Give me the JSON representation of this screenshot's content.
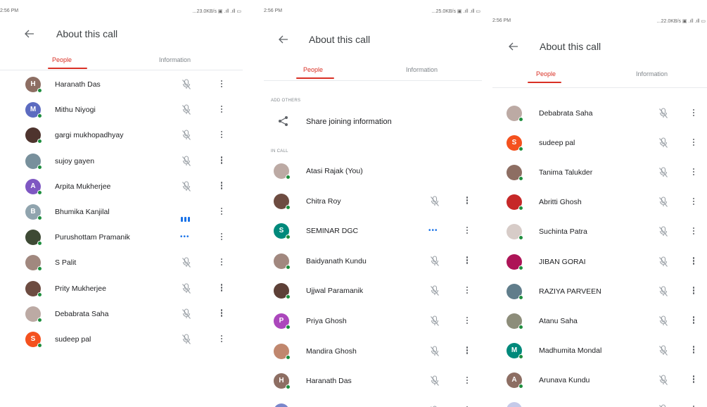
{
  "screens": [
    {
      "status": {
        "time": "2:56 PM",
        "sys": "...23.0KB/s ▣ .ıll .ıll ▭"
      },
      "title": "About this call",
      "tabs": {
        "people": "People",
        "information": "Information"
      },
      "rows": [
        {
          "name": "Haranath Das",
          "initial": "H",
          "color": "#8d6e63",
          "state": "muted"
        },
        {
          "name": "Mithu Niyogi",
          "initial": "M",
          "color": "#5c6bc0",
          "state": "muted"
        },
        {
          "name": "gargi mukhopadhyay",
          "initial": "",
          "color": "#4e342e",
          "state": "muted"
        },
        {
          "name": "sujoy gayen",
          "initial": "",
          "color": "#78909c",
          "state": "muted"
        },
        {
          "name": "Arpita Mukherjee",
          "initial": "A",
          "color": "#7e57c2",
          "state": "muted"
        },
        {
          "name": "Bhumika Kanjilal",
          "initial": "B",
          "color": "#90a4ae",
          "state": "speaking"
        },
        {
          "name": "Purushottam Pramanik",
          "initial": "",
          "color": "#3e4a35",
          "state": "dots"
        },
        {
          "name": "S Palit",
          "initial": "",
          "color": "#a1887f",
          "state": "muted"
        },
        {
          "name": "Prity Mukherjee",
          "initial": "",
          "color": "#6d4c41",
          "state": "muted"
        },
        {
          "name": "Debabrata Saha",
          "initial": "",
          "color": "#bcaaa4",
          "state": "muted"
        },
        {
          "name": "sudeep pal",
          "initial": "S",
          "color": "#f4511e",
          "state": "muted"
        }
      ]
    },
    {
      "status": {
        "time": "2:56 PM",
        "sys": "...25.0KB/s ▣ .ıll .ıll ▭"
      },
      "title": "About this call",
      "tabs": {
        "people": "People",
        "information": "Information"
      },
      "add_others_label": "ADD OTHERS",
      "share_label": "Share joining information",
      "in_call_label": "IN CALL",
      "rows": [
        {
          "name": "Atasi Rajak (You)",
          "initial": "",
          "color": "#bcaaa4",
          "state": "none"
        },
        {
          "name": "Chitra Roy",
          "initial": "",
          "color": "#6d4c41",
          "state": "muted"
        },
        {
          "name": "SEMINAR DGC",
          "initial": "S",
          "color": "#00897b",
          "state": "dots"
        },
        {
          "name": "Baidyanath Kundu",
          "initial": "",
          "color": "#a1887f",
          "state": "muted"
        },
        {
          "name": "Ujjwal Paramanik",
          "initial": "",
          "color": "#5d4037",
          "state": "muted"
        },
        {
          "name": "Priya Ghosh",
          "initial": "P",
          "color": "#ab47bc",
          "state": "muted"
        },
        {
          "name": "Mandira Ghosh",
          "initial": "",
          "color": "#c0876e",
          "state": "muted"
        },
        {
          "name": "Haranath Das",
          "initial": "H",
          "color": "#8d6e63",
          "state": "muted"
        },
        {
          "name": "",
          "initial": "",
          "color": "#7986cb",
          "state": "muted"
        }
      ]
    },
    {
      "status": {
        "time": "2:56 PM",
        "sys": "...22.0KB/s ▣ .ıll .ıll ▭"
      },
      "title": "About this call",
      "tabs": {
        "people": "People",
        "information": "Information"
      },
      "rows": [
        {
          "name": "Debabrata Saha",
          "initial": "",
          "color": "#bcaaa4",
          "state": "muted"
        },
        {
          "name": "sudeep pal",
          "initial": "S",
          "color": "#f4511e",
          "state": "muted"
        },
        {
          "name": "Tanima Talukder",
          "initial": "",
          "color": "#8d6e63",
          "state": "muted"
        },
        {
          "name": "Abritti Ghosh",
          "initial": "",
          "color": "#c62828",
          "state": "muted"
        },
        {
          "name": "Suchinta Patra",
          "initial": "",
          "color": "#d7ccc8",
          "state": "muted"
        },
        {
          "name": "JIBAN GORAI",
          "initial": "",
          "color": "#ad1457",
          "state": "muted"
        },
        {
          "name": "RAZIYA PARVEEN",
          "initial": "",
          "color": "#607d8b",
          "state": "muted"
        },
        {
          "name": "Atanu Saha",
          "initial": "",
          "color": "#8d8d7a",
          "state": "muted"
        },
        {
          "name": "Madhumita Mondal",
          "initial": "M",
          "color": "#00897b",
          "state": "muted"
        },
        {
          "name": "Arunava Kundu",
          "initial": "A",
          "color": "#8d6e63",
          "state": "muted"
        },
        {
          "name": "",
          "initial": "",
          "color": "#c5cae9",
          "state": "muted"
        }
      ]
    }
  ]
}
